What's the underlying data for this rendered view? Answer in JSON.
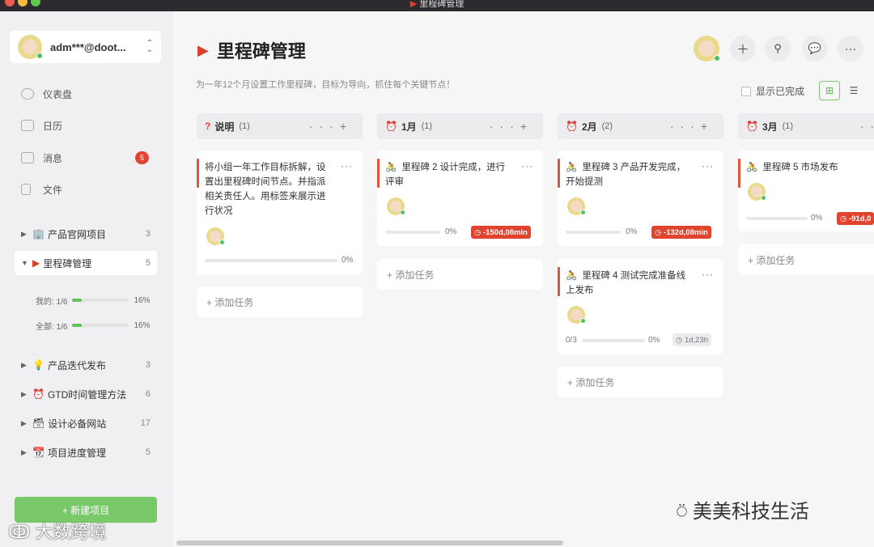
{
  "window": {
    "title": "里程碑管理"
  },
  "account": {
    "name": "adm***@doot..."
  },
  "nav": [
    {
      "label": "仪表盘",
      "icon": "dashboard-icon"
    },
    {
      "label": "日历",
      "icon": "calendar-icon"
    },
    {
      "label": "消息",
      "icon": "message-icon",
      "badge": "5"
    },
    {
      "label": "文件",
      "icon": "file-icon"
    }
  ],
  "projects": [
    {
      "label": "产品官网项目",
      "count": "3",
      "icon": "🏢"
    },
    {
      "label": "里程碑管理",
      "count": "5",
      "icon": "▶",
      "active": true
    },
    {
      "label": "产品迭代发布",
      "count": "3",
      "icon": "💡"
    },
    {
      "label": "GTD时间管理方法",
      "count": "6",
      "icon": "⏰"
    },
    {
      "label": "设计必备网站",
      "count": "17",
      "icon": "🗃"
    },
    {
      "label": "项目进度管理",
      "count": "5",
      "icon": "📆"
    }
  ],
  "progress": [
    {
      "label": "我的: 1/6",
      "pct": "16%",
      "value": 0.16
    },
    {
      "label": "全部: 1/6",
      "pct": "16%",
      "value": 0.16
    }
  ],
  "new_project": "+ 新建项目",
  "header": {
    "title": "里程碑管理",
    "subtitle": "为一年12个月设置工作里程碑，目标为导向，抓住每个关键节点！",
    "show_done": "显示已完成"
  },
  "columns": [
    {
      "icon": "?",
      "title": "说明",
      "count": "(1)"
    },
    {
      "icon": "⏰",
      "title": "1月",
      "count": "(1)"
    },
    {
      "icon": "⏰",
      "title": "2月",
      "count": "(2)"
    },
    {
      "icon": "⏰",
      "title": "3月",
      "count": "(1)"
    }
  ],
  "cards": {
    "c0": {
      "text": "将小组一年工作目标拆解，设置出里程碑时间节点。并指派相关责任人。用标签来展示进行状况",
      "pct": "0%"
    },
    "c1": {
      "text": "里程碑 2 设计完成，进行评审",
      "pct": "0%",
      "due": "-150d,08min"
    },
    "c2": {
      "text": "里程碑 3 产品开发完成，开始提测",
      "pct": "0%",
      "due": "-132d,08min"
    },
    "c3": {
      "text": "里程碑 4 测试完成准备线上发布",
      "pct": "0%",
      "sub": "0/3",
      "due": "1d,23h"
    },
    "c4": {
      "text": "里程碑 5 市场发布",
      "pct": "0%",
      "due": "-91d,0"
    }
  },
  "add_task": "+ 添加任务",
  "watermarks": {
    "left": "大数跨境",
    "right": "美美科技生活"
  }
}
